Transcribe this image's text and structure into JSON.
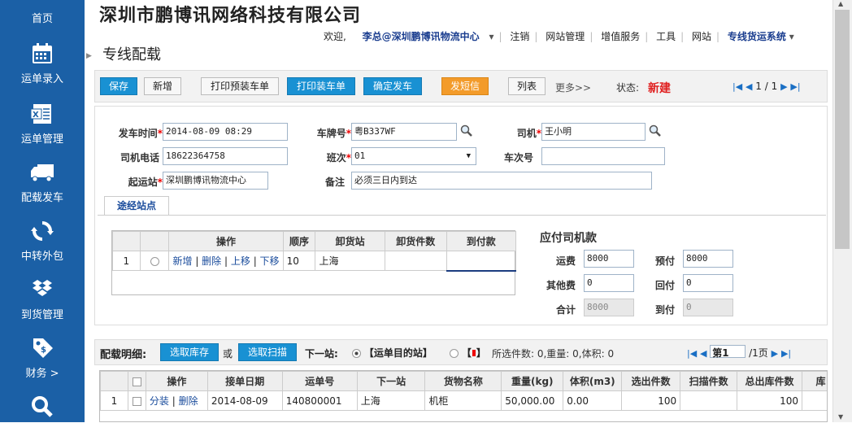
{
  "company": "深圳市鹏博讯网络科技有限公司",
  "page_title": "专线配载",
  "sidebar": [
    {
      "label": "首页",
      "icon": "home-icon"
    },
    {
      "label": "运单录入",
      "icon": "calendar-icon"
    },
    {
      "label": "运单管理",
      "icon": "excel-icon"
    },
    {
      "label": "配载发车",
      "icon": "truck-icon"
    },
    {
      "label": "中转外包",
      "icon": "refresh-icon"
    },
    {
      "label": "到货管理",
      "icon": "dropbox-icon"
    },
    {
      "label": "财务 >",
      "icon": "price-tag-icon"
    },
    {
      "label": "",
      "icon": "search-icon"
    }
  ],
  "topbar": {
    "welcome": "欢迎,",
    "user": "李总@深圳鹏博讯物流中心",
    "logout": "注销",
    "site_admin": "网站管理",
    "value_added": "增值服务",
    "tools": "工具",
    "site": "网站",
    "system": "专线货运系统"
  },
  "toolbar": {
    "save": "保存",
    "new": "新增",
    "print_pre": "打印预装车单",
    "print": "打印装车单",
    "confirm": "确定发车",
    "sms": "发短信",
    "list": "列表",
    "more": "更多>>",
    "status_label": "状态:",
    "status_value": "新建",
    "pager": "1 / 1"
  },
  "form": {
    "depart_time_label": "发车时间",
    "depart_time": "2014-08-09 08:29",
    "plate_label": "车牌号",
    "plate": "粤B337WF",
    "driver_label": "司机",
    "driver": "王小明",
    "driver_phone_label": "司机电话",
    "driver_phone": "18622364758",
    "shift_label": "班次",
    "shift": "01",
    "trip_label": "车次号",
    "trip": "",
    "origin_label": "起运站",
    "origin": "深圳鹏博讯物流中心",
    "note_label": "备注",
    "note": "必须三日内到达"
  },
  "tab_label": "途经站点",
  "stops": {
    "headers": [
      "",
      "",
      "操作",
      "顺序",
      "卸货站",
      "卸货件数",
      "到付款"
    ],
    "rows": [
      {
        "num": "1",
        "actions": [
          "新增",
          "删除",
          "上移",
          "下移"
        ],
        "order": "10",
        "station": "上海",
        "pieces": "",
        "cod": ""
      }
    ]
  },
  "pay": {
    "title": "应付司机款",
    "freight_label": "运费",
    "freight": "8000",
    "prepaid_label": "预付",
    "prepaid": "8000",
    "other_label": "其他费",
    "other": "0",
    "return_label": "回付",
    "return": "0",
    "total_label": "合计",
    "total": "8000",
    "arrival_label": "到付",
    "arrival": "0"
  },
  "detail": {
    "title": "配载明细:",
    "pick_stock": "选取库存",
    "or": "或",
    "pick_scan": "选取扫描",
    "next_stop": "下一站:",
    "opt1": "【运单目的站】",
    "opt2_l": "【",
    "opt2_r": "】",
    "summary": "所选件数: 0,重量: 0,体积: 0",
    "page_prefix": "第1",
    "page_suffix": "/1页"
  },
  "main_grid": {
    "headers": [
      "",
      "",
      "操作",
      "接单日期",
      "运单号",
      "下一站",
      "货物名称",
      "重量(kg)",
      "体积(m3)",
      "选出件数",
      "扫描件数",
      "总出库件数",
      "库"
    ],
    "rows": [
      {
        "num": "1",
        "actions": [
          "分装",
          "删除"
        ],
        "date": "2014-08-09",
        "waybill": "140800001",
        "next": "上海",
        "goods": "机柜",
        "weight": "50,000.00",
        "volume": "0.00",
        "selected": "100",
        "scanned": "",
        "total_out": "100",
        "stock": ""
      }
    ]
  }
}
